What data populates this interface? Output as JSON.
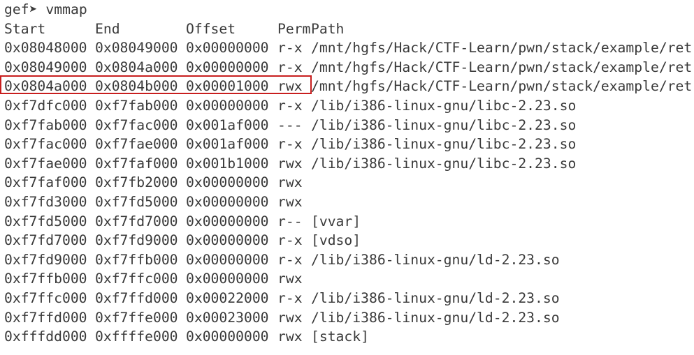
{
  "prompt": {
    "name": "gef",
    "arrow": "➤",
    "command": "vmmap"
  },
  "header": {
    "start": "Start",
    "end": "End",
    "offset": "Offset",
    "perm": "Perm",
    "path": "Path"
  },
  "rows": [
    {
      "start": "0x08048000",
      "end": "0x08049000",
      "offset": "0x00000000",
      "perm": "r-x",
      "path": "/mnt/hgfs/Hack/CTF-Learn/pwn/stack/example/ret"
    },
    {
      "start": "0x08049000",
      "end": "0x0804a000",
      "offset": "0x00000000",
      "perm": "r-x",
      "path": "/mnt/hgfs/Hack/CTF-Learn/pwn/stack/example/ret"
    },
    {
      "start": "0x0804a000",
      "end": "0x0804b000",
      "offset": "0x00001000",
      "perm": "rwx",
      "path": "/mnt/hgfs/Hack/CTF-Learn/pwn/stack/example/ret",
      "highlighted": true
    },
    {
      "start": "0xf7dfc000",
      "end": "0xf7fab000",
      "offset": "0x00000000",
      "perm": "r-x",
      "path": "/lib/i386-linux-gnu/libc-2.23.so"
    },
    {
      "start": "0xf7fab000",
      "end": "0xf7fac000",
      "offset": "0x001af000",
      "perm": "---",
      "path": "/lib/i386-linux-gnu/libc-2.23.so"
    },
    {
      "start": "0xf7fac000",
      "end": "0xf7fae000",
      "offset": "0x001af000",
      "perm": "r-x",
      "path": "/lib/i386-linux-gnu/libc-2.23.so"
    },
    {
      "start": "0xf7fae000",
      "end": "0xf7faf000",
      "offset": "0x001b1000",
      "perm": "rwx",
      "path": "/lib/i386-linux-gnu/libc-2.23.so"
    },
    {
      "start": "0xf7faf000",
      "end": "0xf7fb2000",
      "offset": "0x00000000",
      "perm": "rwx",
      "path": ""
    },
    {
      "start": "0xf7fd3000",
      "end": "0xf7fd5000",
      "offset": "0x00000000",
      "perm": "rwx",
      "path": ""
    },
    {
      "start": "0xf7fd5000",
      "end": "0xf7fd7000",
      "offset": "0x00000000",
      "perm": "r--",
      "path": "[vvar]"
    },
    {
      "start": "0xf7fd7000",
      "end": "0xf7fd9000",
      "offset": "0x00000000",
      "perm": "r-x",
      "path": "[vdso]"
    },
    {
      "start": "0xf7fd9000",
      "end": "0xf7ffb000",
      "offset": "0x00000000",
      "perm": "r-x",
      "path": "/lib/i386-linux-gnu/ld-2.23.so"
    },
    {
      "start": "0xf7ffb000",
      "end": "0xf7ffc000",
      "offset": "0x00000000",
      "perm": "rwx",
      "path": ""
    },
    {
      "start": "0xf7ffc000",
      "end": "0xf7ffd000",
      "offset": "0x00022000",
      "perm": "r-x",
      "path": "/lib/i386-linux-gnu/ld-2.23.so"
    },
    {
      "start": "0xf7ffd000",
      "end": "0xf7ffe000",
      "offset": "0x00023000",
      "perm": "rwx",
      "path": "/lib/i386-linux-gnu/ld-2.23.so"
    },
    {
      "start": "0xfffdd000",
      "end": "0xffffe000",
      "offset": "0x00000000",
      "perm": "rwx",
      "path": "[stack]"
    }
  ],
  "colors": {
    "background": "#ffffff",
    "text": "#3a3a3a",
    "highlight_border": "#c81e1e"
  }
}
